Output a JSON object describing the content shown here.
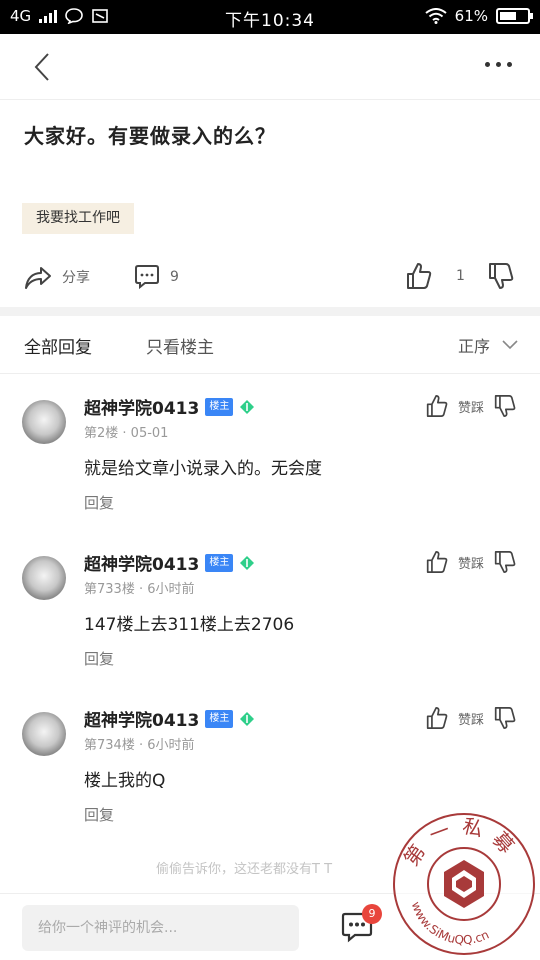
{
  "status": {
    "carrier": "4G",
    "time": "下午10:34",
    "battery_text": "61%",
    "battery_level": 0.61
  },
  "nav": {
    "back_icon": "chevron-left-icon",
    "more_icon": "more-dots-icon"
  },
  "post": {
    "title": "大家好。有要做录入的么？",
    "tag": "我要找工作吧"
  },
  "actions": {
    "share": "分享",
    "comments_count": "9",
    "likes_count": "1"
  },
  "tabs": {
    "all": "全部回复",
    "host_only": "只看楼主",
    "sort": "正序"
  },
  "replies": [
    {
      "name": "超神学院0413",
      "badge": "楼主",
      "meta": "第2楼 · 05-01",
      "content": "就是给文章小说录入的。无会度",
      "reply": "回复",
      "like_label": "赞",
      "dislike_label": "踩"
    },
    {
      "name": "超神学院0413",
      "badge": "楼主",
      "meta": "第733楼 · 6小时前",
      "content": "147楼上去311楼上去2706",
      "reply": "回复",
      "like_label": "赞",
      "dislike_label": "踩"
    },
    {
      "name": "超神学院0413",
      "badge": "楼主",
      "meta": "第734楼 · 6小时前",
      "content": "楼上我的Q",
      "reply": "回复",
      "like_label": "赞",
      "dislike_label": "踩"
    }
  ],
  "footer_hint": "偷偷告诉你，这还老都没有T T",
  "bottom": {
    "placeholder": "给你一个神评的机会...",
    "badge_count": "9"
  },
  "watermark": {
    "text_top": "第一私募",
    "text_bottom": "www.SiMuQQ.cn"
  },
  "colors": {
    "accent_blue": "#3a86f6",
    "badge_red": "#e8453c",
    "watermark_red": "#a83a3a",
    "tag_bg": "#f6efe2"
  }
}
